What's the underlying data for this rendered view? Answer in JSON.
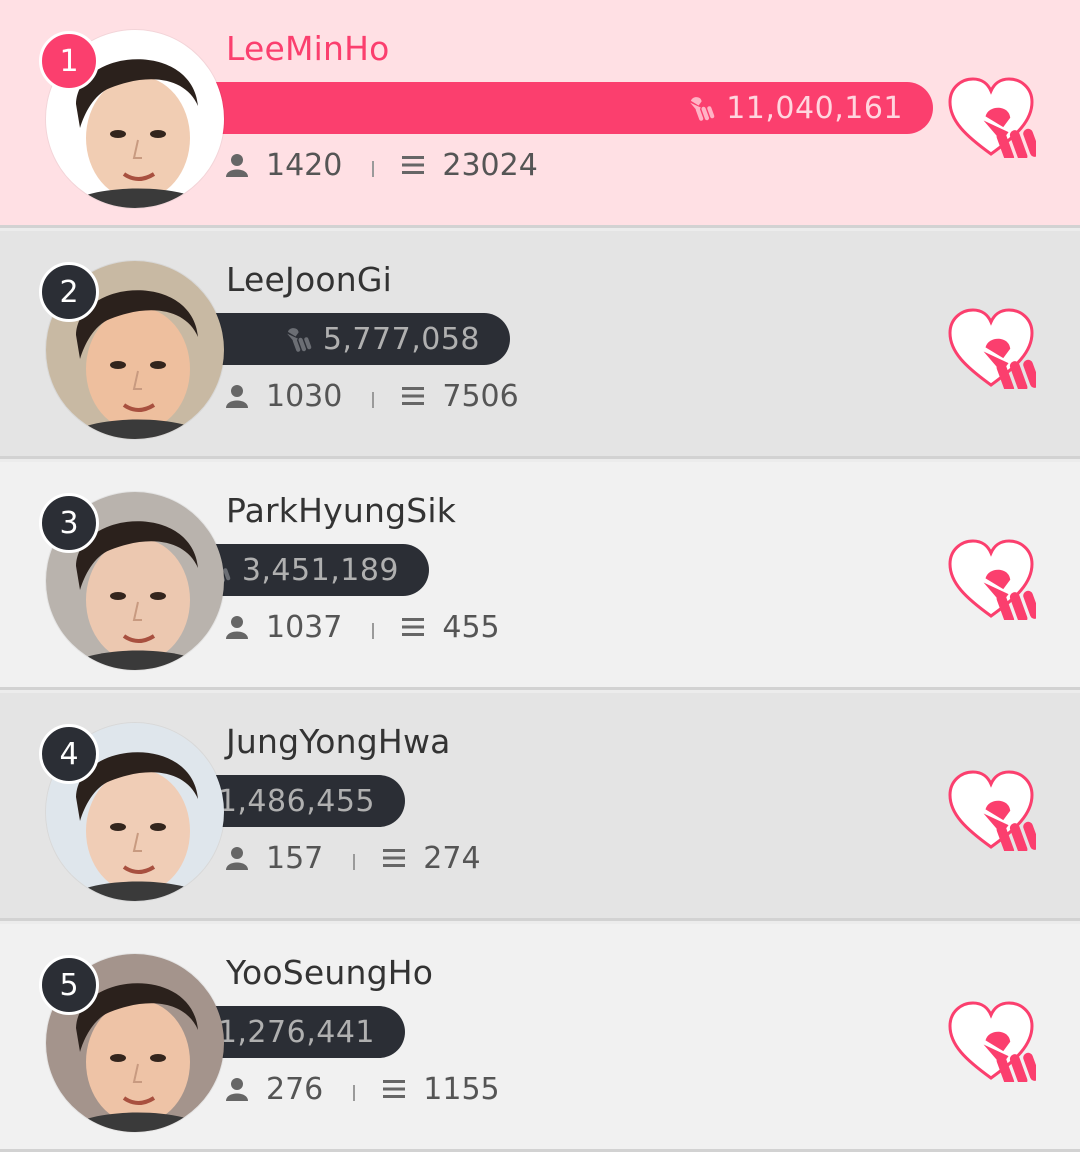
{
  "colors": {
    "accent": "#fb3f6e",
    "bar_dark": "#2b2e35",
    "first_row_bg": "#ffe0e4"
  },
  "icons": {
    "user": "user-icon",
    "list": "list-icon",
    "vote": "finger-heart-icon",
    "vote_button": "heart-vote-icon"
  },
  "ranking": [
    {
      "rank": "1",
      "name": "LeeMinHo",
      "votes": "11,040,161",
      "vote_share": 1.0,
      "supporters": "1420",
      "posts": "23024"
    },
    {
      "rank": "2",
      "name": "LeeJoonGi",
      "votes": "5,777,058",
      "vote_share": 0.523,
      "supporters": "1030",
      "posts": "7506"
    },
    {
      "rank": "3",
      "name": "ParkHyungSik",
      "votes": "3,451,189",
      "vote_share": 0.313,
      "supporters": "1037",
      "posts": "455"
    },
    {
      "rank": "4",
      "name": "JungYongHwa",
      "votes": "1,486,455",
      "vote_share": 0.135,
      "supporters": "157",
      "posts": "274"
    },
    {
      "rank": "5",
      "name": "YooSeungHo",
      "votes": "1,276,441",
      "vote_share": 0.116,
      "supporters": "276",
      "posts": "1155"
    }
  ]
}
